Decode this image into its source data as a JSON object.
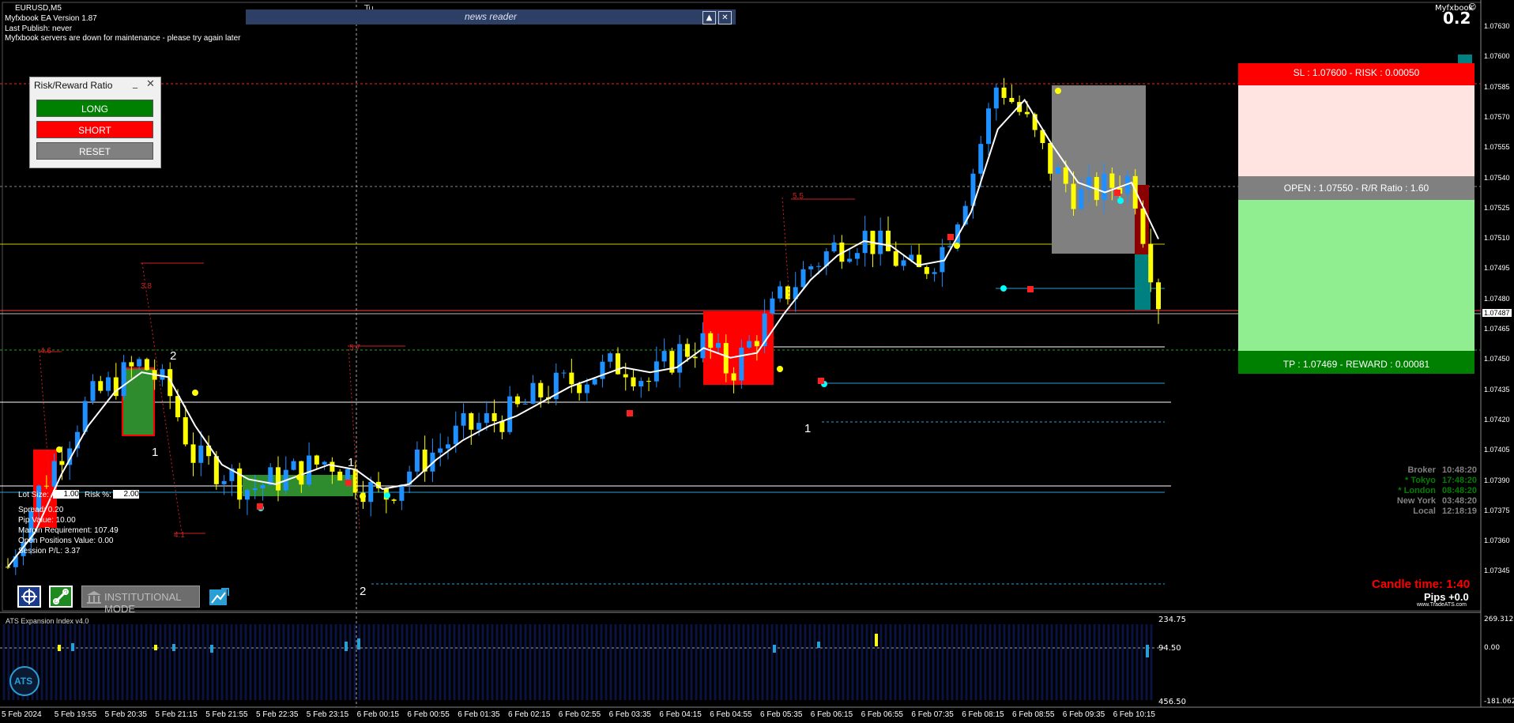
{
  "window": {
    "symbol": "EURUSD,M5",
    "ea_version": "Myfxbook EA Version 1.87",
    "last_publish": "Last Publish: never",
    "server_msg": "Myfxbook servers are down for maintenance - please try again later",
    "top_right_brand": "Myfxbook",
    "top_right_value": "0.2",
    "tu_marker": "Tu"
  },
  "news_reader": {
    "title": "news reader",
    "up_icon": "triangle-up",
    "close_icon": "close"
  },
  "rr_panel": {
    "title": "Risk/Reward Ratio",
    "min_symbol": "_",
    "close_symbol": "✕",
    "long_label": "LONG",
    "short_label": "SHORT",
    "reset_label": "RESET",
    "colors": {
      "long": "#008000",
      "short": "#ff0000",
      "reset": "#808080"
    }
  },
  "rr_box": {
    "sl_text": "SL : 1.07600 - RISK : 0.00050",
    "open_text": "OPEN : 1.07550 - R/R Ratio : 1.60",
    "tp_text": "TP : 1.07469 - REWARD : 0.00081",
    "colors": {
      "sl": "#ff0000",
      "risk_zone": "#ffe4e1",
      "open": "#808080",
      "reward_zone": "#90ee90",
      "tp": "#008000"
    }
  },
  "trade_stats": {
    "lot_label": "Lot Size:",
    "lot_value": "1.00",
    "risk_label": "Risk %:",
    "risk_value": "2.00",
    "spread": "Spread: 0.20",
    "pip_value": "Pip Value: 10.00",
    "margin": "Margin Requirement: 107.49",
    "open_positions": "Open Positions Value: 0.00",
    "session_pl": "Session P/L: 3.37"
  },
  "toolbar": {
    "inst_mode": "INSTITUTIONAL MODE",
    "icons": [
      "crosshair-icon",
      "link-icon",
      "bank-icon",
      "expand-icon"
    ]
  },
  "clocks": [
    {
      "label": "Broker",
      "time": "10:48:20",
      "color": "#808080"
    },
    {
      "label": "* Tokyo",
      "time": "17:48:20",
      "color": "#008000"
    },
    {
      "label": "* London",
      "time": "08:48:20",
      "color": "#008000"
    },
    {
      "label": "New York",
      "time": "03:48:20",
      "color": "#808080"
    },
    {
      "label": "Local",
      "time": "12:18:19",
      "color": "#808080"
    }
  ],
  "candle_timer": {
    "label": "Candle time:",
    "value": "1:40",
    "pips": "Pips +0.0",
    "site": "www.TradeATS.com"
  },
  "chart_labels": [
    {
      "text": "4.6"
    },
    {
      "text": "3.8"
    },
    {
      "text": "5.7"
    },
    {
      "text": "4.1"
    },
    {
      "text": "5.5"
    },
    {
      "text": "2"
    },
    {
      "text": "1"
    },
    {
      "text": "1"
    },
    {
      "text": "2"
    },
    {
      "text": "1"
    }
  ],
  "price_axis": [
    "1.07630",
    "1.07600",
    "1.07585",
    "1.07570",
    "1.07555",
    "1.07540",
    "1.07525",
    "1.07510",
    "1.07495",
    "1.07480",
    "1.07465",
    "1.07450",
    "1.07435",
    "1.07420",
    "1.07405",
    "1.07390",
    "1.07375",
    "1.07360",
    "1.07345"
  ],
  "current_price": "1.07487",
  "time_axis": [
    "5 Feb 2024",
    "5 Feb 19:55",
    "5 Feb 20:35",
    "5 Feb 21:15",
    "5 Feb 21:55",
    "5 Feb 22:35",
    "5 Feb 23:15",
    "6 Feb 00:15",
    "6 Feb 00:55",
    "6 Feb 01:35",
    "6 Feb 02:15",
    "6 Feb 02:55",
    "6 Feb 03:35",
    "6 Feb 04:15",
    "6 Feb 04:55",
    "6 Feb 05:35",
    "6 Feb 06:15",
    "6 Feb 06:55",
    "6 Feb 07:35",
    "6 Feb 08:15",
    "6 Feb 08:55",
    "6 Feb 09:35",
    "6 Feb 10:15"
  ],
  "indicator": {
    "name": "ATS Expansion Index v4.0",
    "upper": "234.75",
    "mid": "94.50",
    "lower": "456.50",
    "axis_top": "269.3125",
    "axis_mid": "0.00",
    "axis_bot": "-181.0625"
  },
  "chart_data": {
    "type": "candlestick",
    "symbol": "EURUSD",
    "timeframe": "M5",
    "ylim": [
      1.0734,
      1.0763
    ],
    "bull_color": "#1e90ff",
    "bear_color": "#ffff00",
    "close_path": [
      1.0735,
      1.07385,
      1.0741,
      1.07435,
      1.07445,
      1.07455,
      1.0744,
      1.07405,
      1.074,
      1.0739,
      1.07395,
      1.074,
      1.07405,
      1.07395,
      1.07385,
      1.074,
      1.0741,
      1.0742,
      1.07425,
      1.0743,
      1.0744,
      1.07445,
      1.0745,
      1.07455,
      1.07445,
      1.0746,
      1.07465,
      1.0745,
      1.0747,
      1.0749,
      1.07505,
      1.07515,
      1.0752,
      1.0751,
      1.075,
      1.07515,
      1.0755,
      1.076,
      1.0758,
      1.07555,
      1.0754,
      1.07545,
      1.0755,
      1.07487
    ]
  }
}
